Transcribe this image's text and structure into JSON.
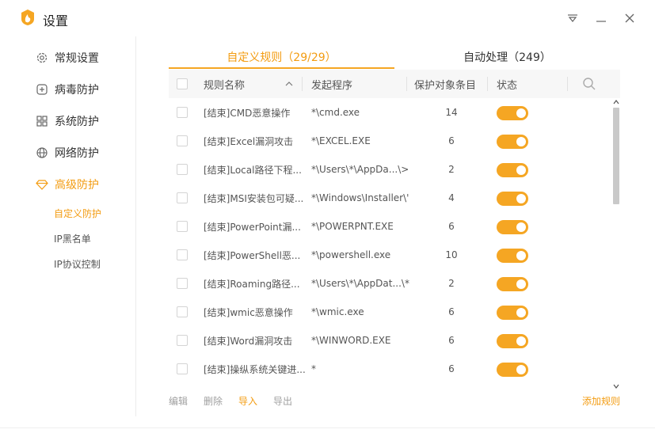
{
  "window": {
    "title": "设置"
  },
  "sidebar": {
    "items": [
      {
        "label": "常规设置",
        "icon": "gear-icon"
      },
      {
        "label": "病毒防护",
        "icon": "plus-box-icon"
      },
      {
        "label": "系统防护",
        "icon": "grid-icon"
      },
      {
        "label": "网络防护",
        "icon": "globe-icon"
      },
      {
        "label": "高级防护",
        "icon": "diamond-icon"
      }
    ],
    "sub_items": [
      "自定义防护",
      "IP黑名单",
      "IP协议控制"
    ],
    "active_item": "高级防护",
    "active_sub_item": "自定义防护"
  },
  "tabs": [
    {
      "label": "自定义规则（29/29）",
      "active": true
    },
    {
      "label": "自动处理（249）",
      "active": false
    }
  ],
  "table": {
    "headers": {
      "name": "规则名称",
      "program": "发起程序",
      "count": "保护对象条目",
      "status": "状态"
    },
    "rows": [
      {
        "name": "[结束]CMD恶意操作",
        "program": "*\\cmd.exe",
        "count": "14",
        "enabled": true
      },
      {
        "name": "[结束]Excel漏洞攻击",
        "program": "*\\EXCEL.EXE",
        "count": "6",
        "enabled": true
      },
      {
        "name": "[结束]Local路径下程...",
        "program": "*\\Users\\*\\AppDa...\\>",
        "count": "2",
        "enabled": true
      },
      {
        "name": "[结束]MSI安装包可疑...",
        "program": "*\\Windows\\Installer\\'",
        "count": "4",
        "enabled": true
      },
      {
        "name": "[结束]PowerPoint漏...",
        "program": "*\\POWERPNT.EXE",
        "count": "6",
        "enabled": true
      },
      {
        "name": "[结束]PowerShell恶...",
        "program": "*\\powershell.exe",
        "count": "10",
        "enabled": true
      },
      {
        "name": "[结束]Roaming路径...",
        "program": "*\\Users\\*\\AppDat...\\*",
        "count": "2",
        "enabled": true
      },
      {
        "name": "[结束]wmic恶意操作",
        "program": "*\\wmic.exe",
        "count": "6",
        "enabled": true
      },
      {
        "name": "[结束]Word漏洞攻击",
        "program": "*\\WINWORD.EXE",
        "count": "6",
        "enabled": true
      },
      {
        "name": "[结束]操纵系统关键进...",
        "program": "*",
        "count": "6",
        "enabled": true
      }
    ]
  },
  "footer": {
    "edit": "编辑",
    "delete": "删除",
    "import": "导入",
    "export": "导出",
    "add_rule": "添加规则"
  },
  "colors": {
    "accent": "#f5a623",
    "accent_text": "#f39c12",
    "disabled_text": "#a0a0a0"
  }
}
